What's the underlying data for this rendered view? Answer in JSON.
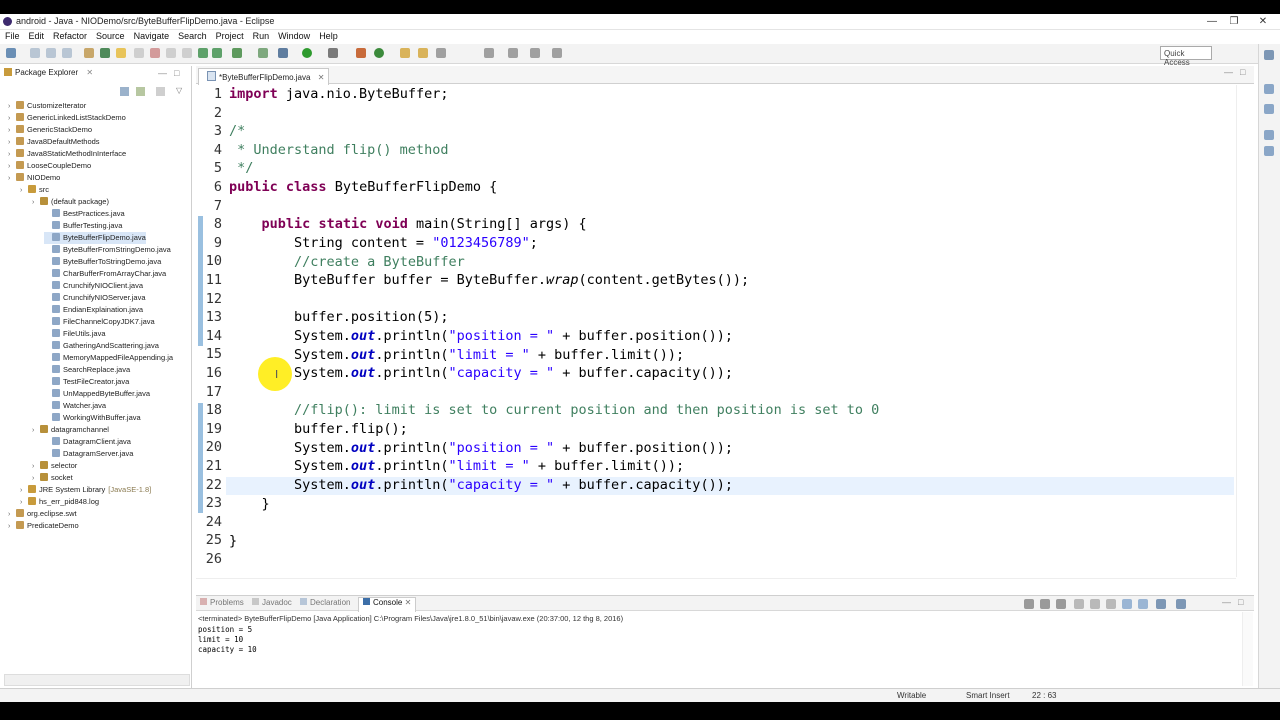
{
  "window": {
    "title": "android - Java - NIODemo/src/ByteBufferFlipDemo.java - Eclipse",
    "controls": [
      "—",
      "❐",
      "✕"
    ]
  },
  "menu": [
    "File",
    "Edit",
    "Refactor",
    "Source",
    "Navigate",
    "Search",
    "Project",
    "Run",
    "Window",
    "Help"
  ],
  "toolbar": {
    "quick_access": "Quick Access"
  },
  "package_explorer": {
    "title": "Package Explorer",
    "items": [
      {
        "label": "CustomizeIterator",
        "depth": 0
      },
      {
        "label": "GenericLinkedListStackDemo",
        "depth": 0
      },
      {
        "label": "GenericStackDemo",
        "depth": 0
      },
      {
        "label": "Java8DefaultMethods",
        "depth": 0
      },
      {
        "label": "Java8StaticMethodInInterface",
        "depth": 0
      },
      {
        "label": "LooseCoupleDemo",
        "depth": 0
      },
      {
        "label": "NIODemo",
        "depth": 0
      },
      {
        "label": "src",
        "depth": 1
      },
      {
        "label": "(default package)",
        "depth": 2
      },
      {
        "label": "BestPractices.java",
        "depth": 3
      },
      {
        "label": "BufferTesting.java",
        "depth": 3
      },
      {
        "label": "ByteBufferFlipDemo.java",
        "depth": 3
      },
      {
        "label": "ByteBufferFromStringDemo.java",
        "depth": 3
      },
      {
        "label": "ByteBufferToStringDemo.java",
        "depth": 3
      },
      {
        "label": "CharBufferFromArrayChar.java",
        "depth": 3
      },
      {
        "label": "CrunchifyNIOClient.java",
        "depth": 3
      },
      {
        "label": "CrunchifyNIOServer.java",
        "depth": 3
      },
      {
        "label": "EndianExplaination.java",
        "depth": 3
      },
      {
        "label": "FileChannelCopyJDK7.java",
        "depth": 3
      },
      {
        "label": "FileUtils.java",
        "depth": 3
      },
      {
        "label": "GatheringAndScattering.java",
        "depth": 3
      },
      {
        "label": "MemoryMappedFileAppending.ja",
        "depth": 3
      },
      {
        "label": "SearchReplace.java",
        "depth": 3
      },
      {
        "label": "TestFileCreator.java",
        "depth": 3
      },
      {
        "label": "UnMappedByteBuffer.java",
        "depth": 3
      },
      {
        "label": "Watcher.java",
        "depth": 3
      },
      {
        "label": "WorkingWithBuffer.java",
        "depth": 3
      },
      {
        "label": "datagramchannel",
        "depth": 2
      },
      {
        "label": "DatagramClient.java",
        "depth": 3
      },
      {
        "label": "DatagramServer.java",
        "depth": 3
      },
      {
        "label": "selector",
        "depth": 2
      },
      {
        "label": "socket",
        "depth": 2
      },
      {
        "label": "JRE System Library",
        "suffix": "[JavaSE-1.8]",
        "depth": 1
      },
      {
        "label": "hs_err_pid848.log",
        "depth": 1
      },
      {
        "label": "org.eclipse.swt",
        "depth": 0
      },
      {
        "label": "PredicateDemo",
        "depth": 0
      }
    ]
  },
  "editor": {
    "tab_label": "*ByteBufferFlipDemo.java",
    "line_numbers": [
      "1",
      "2",
      "3",
      "4",
      "5",
      "6",
      "7",
      "8",
      "9",
      "10",
      "11",
      "12",
      "13",
      "14",
      "15",
      "16",
      "17",
      "18",
      "19",
      "20",
      "21",
      "22",
      "23",
      "24",
      "25",
      "26"
    ]
  },
  "console": {
    "tabs": [
      "Problems",
      "Javadoc",
      "Declaration",
      "Console"
    ],
    "header": "<terminated> ByteBufferFlipDemo [Java Application] C:\\Program Files\\Java\\jre1.8.0_51\\bin\\javaw.exe (20:37:00, 12 thg 8, 2016)",
    "lines": [
      "position = 5",
      "limit = 10",
      "capacity = 10"
    ]
  },
  "status": {
    "writable": "Writable",
    "insert_mode": "Smart Insert",
    "position": "22 : 63"
  }
}
